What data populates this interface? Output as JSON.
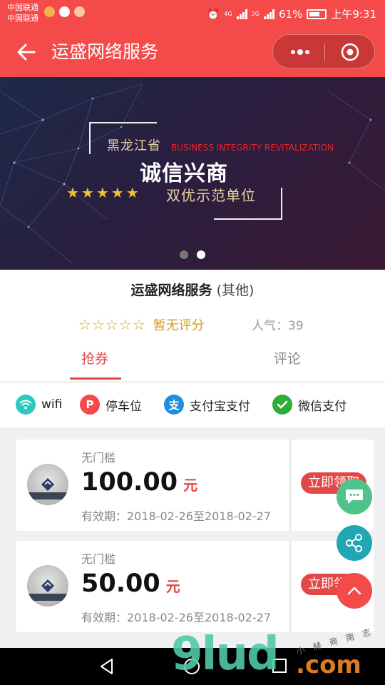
{
  "status_bar": {
    "carrier_1": "中国联通",
    "carrier_2": "中国联通",
    "battery": "61%",
    "time": "上午9:31",
    "network_1": "4G",
    "network_2": "2G"
  },
  "nav": {
    "title": "运盛网络服务"
  },
  "banner": {
    "province": "黑龙江省",
    "english": "BUSINESS INTEGRITY REVITALIZATION",
    "headline": "诚信兴商",
    "stars": "★★★★★",
    "subtitle": "双优示范单位",
    "active_slide": 2,
    "slides": 2
  },
  "shop": {
    "name": "运盛网络服务",
    "category": "(其他)",
    "rating_stars": "☆☆☆☆☆",
    "rating_text": "暂无评分",
    "popularity": "人气：39"
  },
  "tabs": [
    {
      "label": "抢券",
      "active": true
    },
    {
      "label": "评论",
      "active": false
    }
  ],
  "facilities": [
    {
      "label": "wifi",
      "icon": "wifi-icon",
      "color": "#2dc8c0"
    },
    {
      "label": "停车位",
      "icon": "parking-icon",
      "color": "#f44a4a",
      "glyph": "P"
    },
    {
      "label": "支付宝支付",
      "icon": "alipay-icon",
      "color": "#1f8ee0",
      "glyph": "支"
    },
    {
      "label": "微信支付",
      "icon": "wechat-pay-icon",
      "color": "#2aae36"
    }
  ],
  "coupons": [
    {
      "condition": "无门槛",
      "amount": "100.00",
      "unit": "元",
      "validity": "有效期：2018-02-26至2018-02-27",
      "button": "立即领取"
    },
    {
      "condition": "无门槛",
      "amount": "50.00",
      "unit": "元",
      "validity": "有效期：2018-02-26至2018-02-27",
      "button": "立即领取"
    }
  ],
  "watermark": {
    "brand": "9lud",
    "domain": ".com",
    "chinese": "小 赫 商 南 志"
  },
  "colors": {
    "primary": "#f44a4a",
    "accent_text": "#e34848",
    "rating": "#d9a521"
  }
}
